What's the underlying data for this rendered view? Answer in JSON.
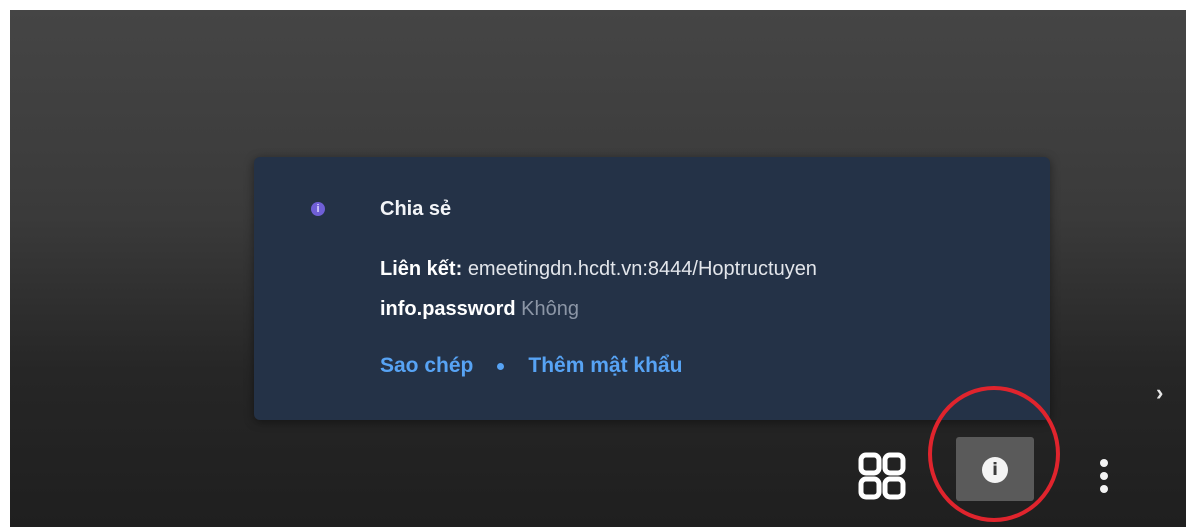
{
  "share_popup": {
    "title": "Chia sẻ",
    "link_label": "Liên kết:",
    "link_value": "emeetingdn.hcdt.vn:8444/Hoptructuyen",
    "password_label": "info.password",
    "password_value": "Không",
    "copy_action": "Sao chép",
    "add_password_action": "Thêm mật khẩu",
    "info_icon": "info-icon"
  },
  "toolbar": {
    "chevron_glyph": "›",
    "grid_icon": "grid-icon",
    "info_icon": "info-icon",
    "info_glyph": "i",
    "more_icon": "more-vert-icon"
  },
  "colors": {
    "popup_bg": "#243247",
    "link_blue": "#57a3f4",
    "info_purple": "#6f5fd6",
    "annotation_red": "#e0242d"
  }
}
